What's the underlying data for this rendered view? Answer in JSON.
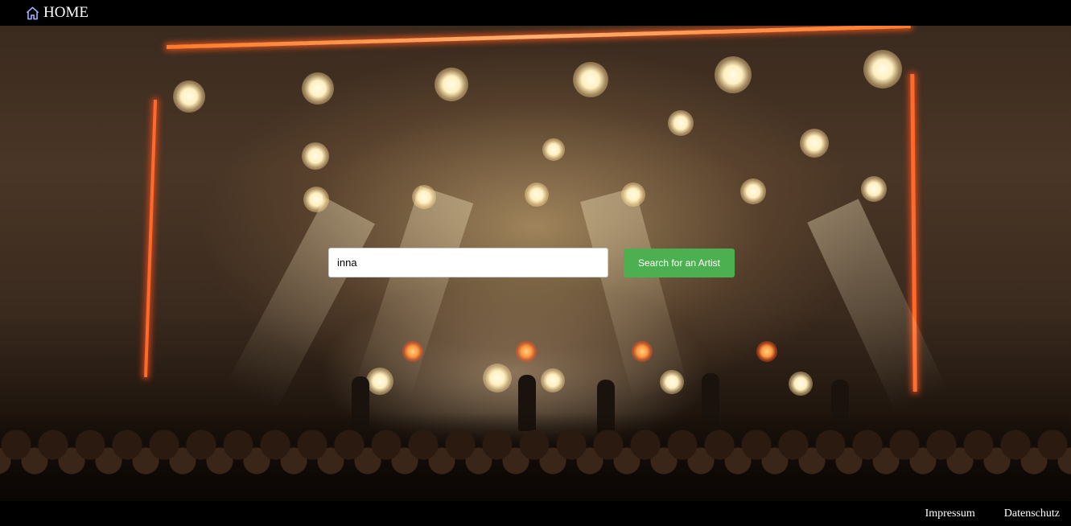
{
  "header": {
    "home_label": "HOME",
    "home_icon": "home-icon"
  },
  "search": {
    "value": "inna",
    "button_label": "Search for an Artist"
  },
  "footer": {
    "links": [
      "Impressum",
      "Datenschutz"
    ]
  },
  "colors": {
    "topbar_bg": "#000000",
    "button_bg": "#4caf50",
    "button_text": "#ffffff"
  },
  "background": {
    "description": "concert-stage-photo"
  }
}
